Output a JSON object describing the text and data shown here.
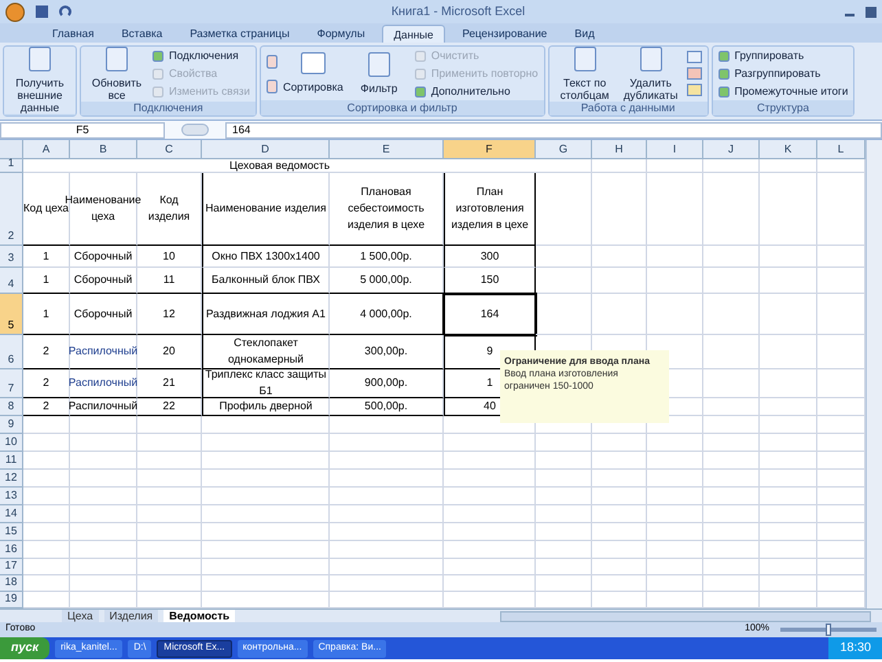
{
  "window": {
    "title": "Книга1 - Microsoft Excel"
  },
  "ribbon_tabs": [
    {
      "label": "Главная",
      "selected": false
    },
    {
      "label": "Вставка",
      "selected": false
    },
    {
      "label": "Разметка страницы",
      "selected": false
    },
    {
      "label": "Формулы",
      "selected": false
    },
    {
      "label": "Данные",
      "selected": true
    },
    {
      "label": "Рецензирование",
      "selected": false
    },
    {
      "label": "Вид",
      "selected": false
    }
  ],
  "ribbon_groups": [
    {
      "items": [
        {
          "kind": "big",
          "label": "Получить внешние данные",
          "disabled": false
        }
      ]
    },
    {
      "title": "Подключения",
      "items": [
        {
          "kind": "big",
          "label": "Обновить все",
          "disabled": false
        },
        {
          "kind": "small",
          "label": "Подключения",
          "disabled": false
        },
        {
          "kind": "small",
          "label": "Свойства",
          "disabled": true
        },
        {
          "kind": "small",
          "label": "Изменить связи",
          "disabled": true
        }
      ]
    },
    {
      "title": "Сортировка и фильтр",
      "items": [
        {
          "kind": "sort",
          "label": "Сортировка",
          "disabled": false
        },
        {
          "kind": "big",
          "label": "Фильтр",
          "disabled": false
        },
        {
          "kind": "small",
          "label": "Очистить",
          "disabled": true
        },
        {
          "kind": "small",
          "label": "Применить повторно",
          "disabled": true
        },
        {
          "kind": "small",
          "label": "Дополнительно",
          "disabled": false
        }
      ]
    },
    {
      "title": "Работа с данными",
      "items": [
        {
          "kind": "big",
          "label": "Текст по столбцам",
          "disabled": false
        },
        {
          "kind": "big",
          "label": "Удалить дубликаты",
          "disabled": false
        },
        {
          "kind": "tools",
          "disabled": false
        }
      ]
    },
    {
      "title": "Структура",
      "items": [
        {
          "kind": "small",
          "label": "Группировать",
          "disabled": false
        },
        {
          "kind": "small",
          "label": "Разгруппировать",
          "disabled": false
        },
        {
          "kind": "small",
          "label": "Промежуточные итоги",
          "disabled": false
        }
      ]
    }
  ],
  "formula_bar": {
    "name_box": "F5",
    "formula": "164"
  },
  "columns": [
    {
      "label": "A",
      "selected": false
    },
    {
      "label": "B",
      "selected": false
    },
    {
      "label": "C",
      "selected": false
    },
    {
      "label": "D",
      "selected": false
    },
    {
      "label": "E",
      "selected": false
    },
    {
      "label": "F",
      "selected": true
    },
    {
      "label": "G",
      "selected": false
    },
    {
      "label": "H",
      "selected": false
    },
    {
      "label": "I",
      "selected": false
    },
    {
      "label": "J",
      "selected": false
    },
    {
      "label": "K",
      "selected": false
    },
    {
      "label": "L",
      "selected": false
    }
  ],
  "rows": [
    {
      "number": "1",
      "selected": false
    },
    {
      "number": "2",
      "selected": false
    },
    {
      "number": "3",
      "selected": false
    },
    {
      "number": "4",
      "selected": false
    },
    {
      "number": "5",
      "selected": true
    },
    {
      "number": "6",
      "selected": false
    },
    {
      "number": "7",
      "selected": false
    },
    {
      "number": "8",
      "selected": false
    },
    {
      "number": "9",
      "selected": false
    },
    {
      "number": "10",
      "selected": false
    },
    {
      "number": "11",
      "selected": false
    },
    {
      "number": "12",
      "selected": false
    },
    {
      "number": "13",
      "selected": false
    },
    {
      "number": "14",
      "selected": false
    },
    {
      "number": "15",
      "selected": false
    },
    {
      "number": "16",
      "selected": false
    },
    {
      "number": "17",
      "selected": false
    },
    {
      "number": "18",
      "selected": false
    },
    {
      "number": "19",
      "selected": false
    }
  ],
  "sheet": {
    "title": "Цеховая ведомость",
    "headers": [
      "Код цеха",
      "Наименование цеха",
      "Код изделия",
      "Наименование изделия",
      "Плановая себестоимость изделия в цехе",
      "План изготовления изделия в цехе"
    ],
    "data": [
      [
        "1",
        "Сборочный",
        "10",
        "Окно ПВХ 1300x1400",
        "1 500,00р.",
        "300"
      ],
      [
        "1",
        "Сборочный",
        "11",
        "Балконный блок ПВХ",
        "5 000,00р.",
        "150"
      ],
      [
        "1",
        "Сборочный",
        "12",
        "Раздвижная лоджия А1",
        "4 000,00р.",
        "164"
      ],
      [
        "2",
        "Распилочный",
        "20",
        "Стеклопакет однокамерный",
        "300,00р.",
        "9"
      ],
      [
        "2",
        "Распилочный",
        "21",
        "Триплекс класс защиты Б1",
        "900,00р.",
        "1"
      ],
      [
        "2",
        "Распилочный",
        "22",
        "Профиль дверной",
        "500,00р.",
        "40"
      ]
    ]
  },
  "tooltip": {
    "title": "Ограничение для ввода плана",
    "text": "Ввод плана изготовления ограничен 150-1000"
  },
  "sheet_tabs": [
    {
      "label": "Цеха",
      "selected": false
    },
    {
      "label": "Изделия",
      "selected": false
    },
    {
      "label": "Ведомость",
      "selected": true
    }
  ],
  "status_bar": {
    "status": "Готово",
    "zoom": "100%",
    "level": 0.5
  },
  "taskbar": {
    "start": "пуск",
    "items": [
      {
        "label": "rika_kanitel...",
        "selected": false
      },
      {
        "label": "D:\\",
        "selected": false
      },
      {
        "label": "Microsoft Ex...",
        "selected": true
      },
      {
        "label": "контрольна...",
        "selected": false
      },
      {
        "label": "Справка: Ви...",
        "selected": false
      }
    ],
    "clock": "18:30"
  }
}
